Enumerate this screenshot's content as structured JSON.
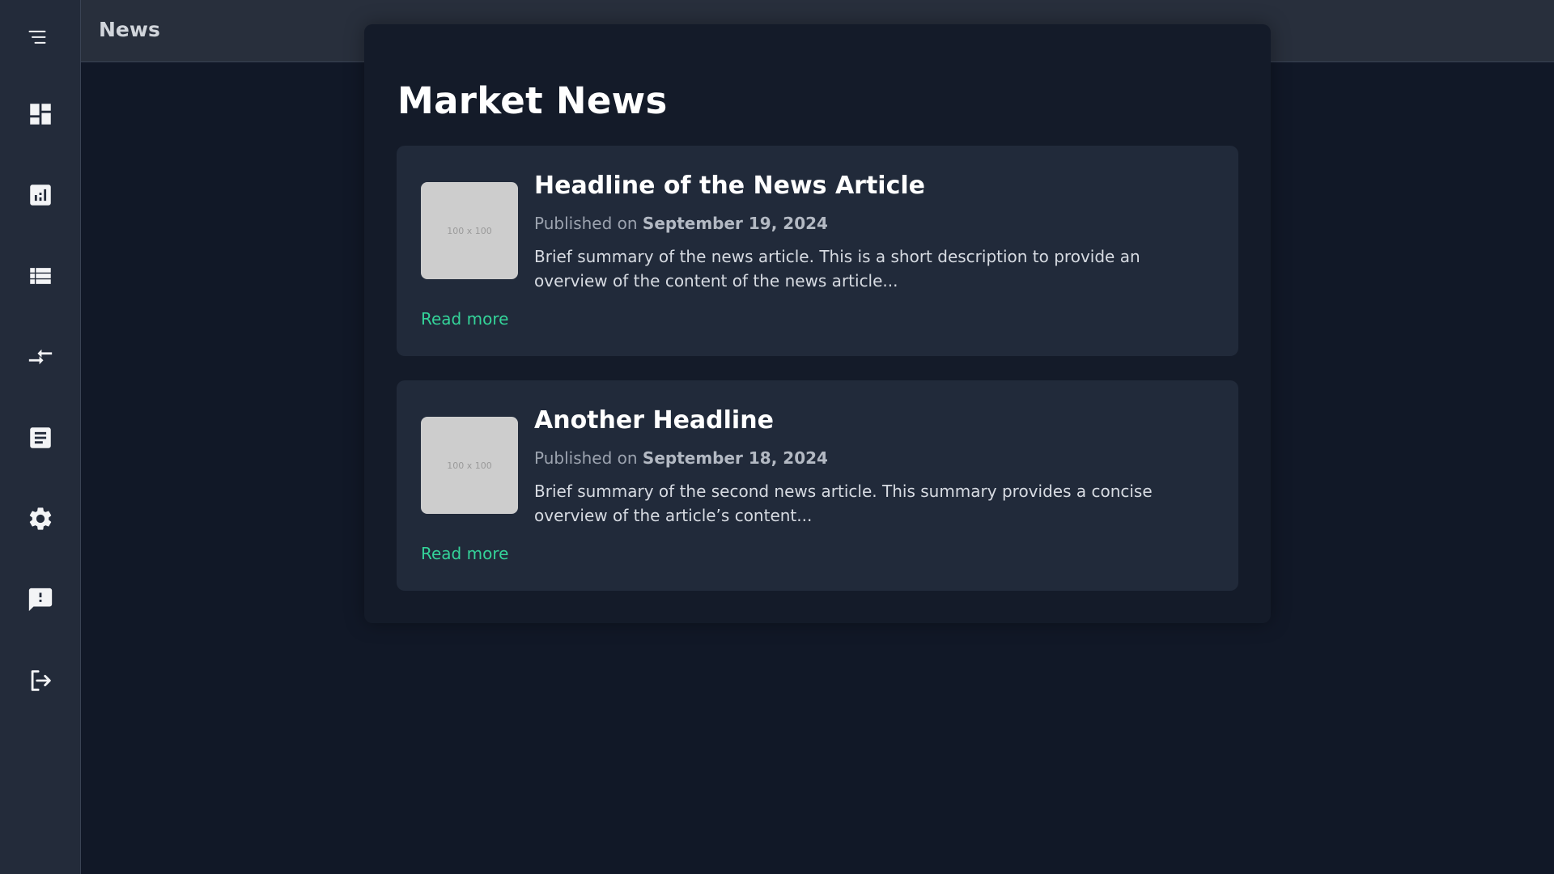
{
  "header": {
    "title": "News"
  },
  "sidebar": {
    "items": [
      {
        "icon": "dashboard-icon"
      },
      {
        "icon": "analytics-icon"
      },
      {
        "icon": "list-icon"
      },
      {
        "icon": "transfer-icon"
      },
      {
        "icon": "article-icon"
      },
      {
        "icon": "gear-icon"
      },
      {
        "icon": "feedback-icon"
      },
      {
        "icon": "logout-icon"
      }
    ]
  },
  "main": {
    "title": "Market News",
    "articles": [
      {
        "image_label": "100 x 100",
        "headline": "Headline of the News Article",
        "published_prefix": "Published on",
        "date": "September 19, 2024",
        "summary": "Brief summary of the news article. This is a short description to provide an overview of the content of the news article...",
        "link_label": "Read more"
      },
      {
        "image_label": "100 x 100",
        "headline": "Another Headline",
        "published_prefix": "Published on",
        "date": "September 18, 2024",
        "summary": "Brief summary of the second news article. This summary provides a concise overview of the article’s content...",
        "link_label": "Read more"
      }
    ]
  },
  "colors": {
    "background": "#111827",
    "sidebar": "#232b3a",
    "card": "#212a3a",
    "accent": "#34d399"
  }
}
